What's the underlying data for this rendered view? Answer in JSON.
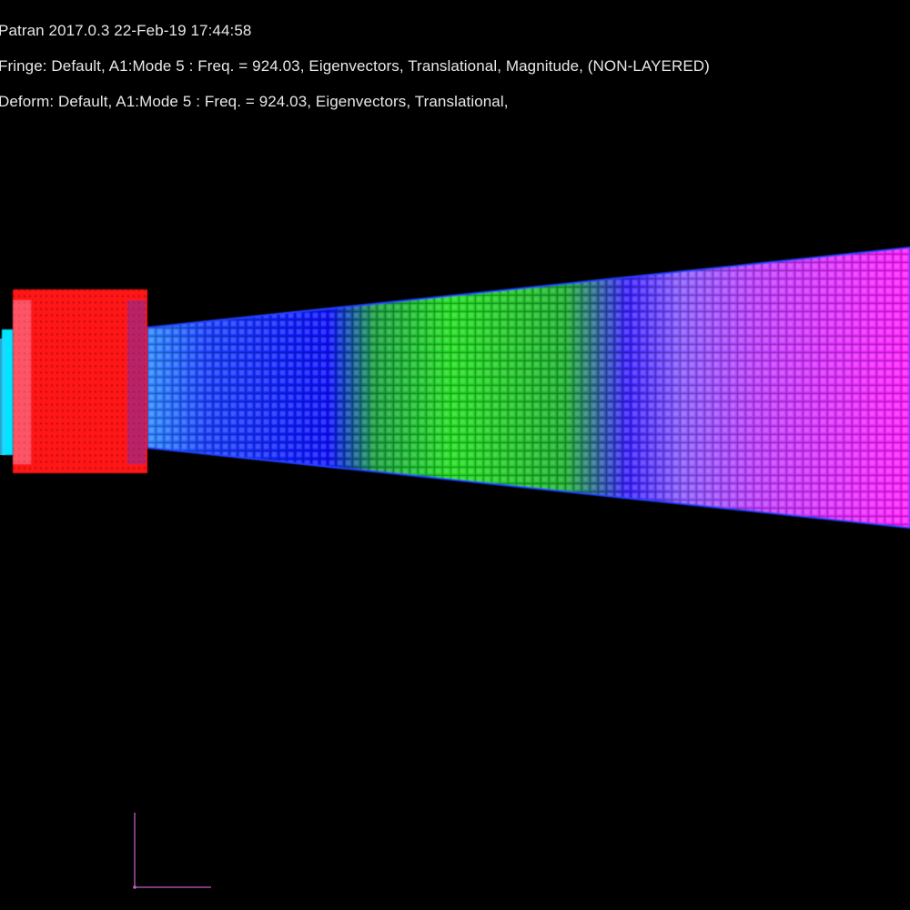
{
  "viewport": {
    "title_line": "Patran 2017.0.3 22-Feb-19 17:44:58",
    "fringe_line": "Fringe: Default, A1:Mode 5 : Freq. = 924.03, Eigenvectors, Translational, Magnitude, (NON-LAYERED)",
    "deform_line": "Deform: Default, A1:Mode 5 : Freq. = 924.03, Eigenvectors, Translational,"
  },
  "colors": {
    "background": "#000000",
    "hub": "#ff1a1a",
    "hub_edge": "#00e5ff",
    "blade_root": "#2a6bff",
    "blade_low": "#0a10ff",
    "blade_mid": "#22dd22",
    "blade_high": "#7a22ff",
    "blade_tip": "#ff30ff",
    "triad": "#c060c0"
  },
  "icons": {
    "axis_triad": "axis-triad-icon"
  }
}
